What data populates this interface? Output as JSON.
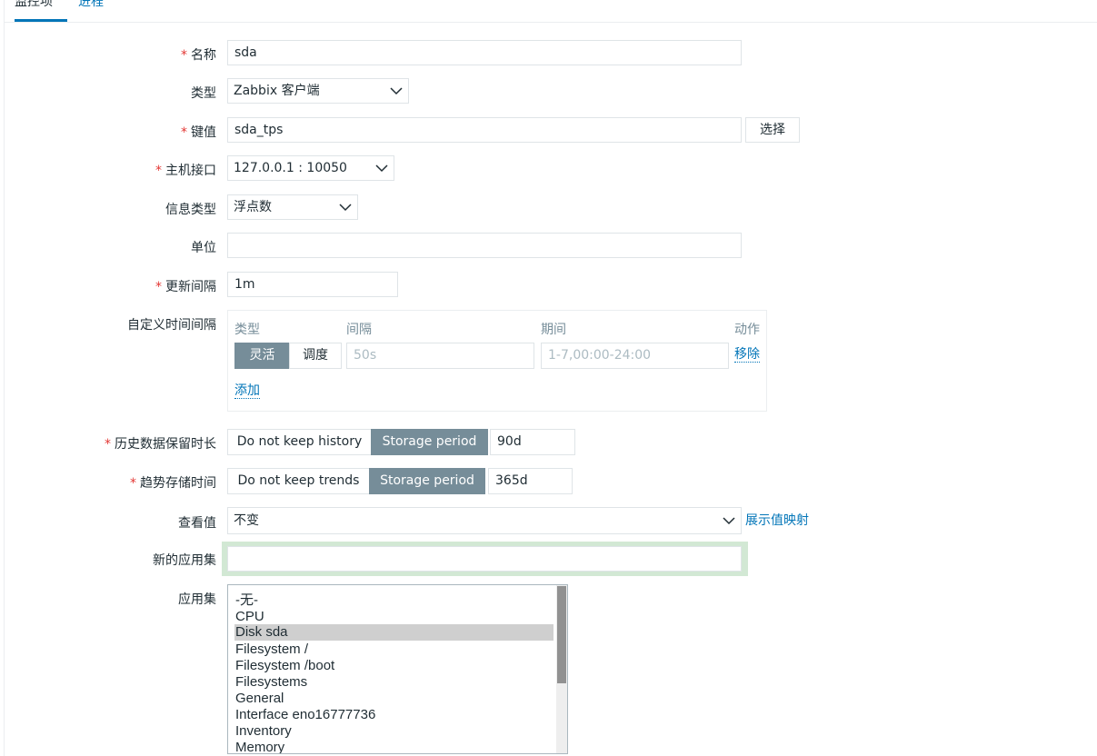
{
  "tabs": [
    {
      "label": "监控项"
    },
    {
      "label": "进程"
    }
  ],
  "form": {
    "required_mark": "*",
    "name": {
      "label": "名称",
      "value": "sda"
    },
    "type": {
      "label": "类型",
      "value": "Zabbix 客户端"
    },
    "key": {
      "label": "键值",
      "value": "sda_tps",
      "select_button": "选择"
    },
    "interface": {
      "label": "主机接口",
      "value": "127.0.0.1 : 10050"
    },
    "info_type": {
      "label": "信息类型",
      "value": "浮点数"
    },
    "units": {
      "label": "单位",
      "value": ""
    },
    "update_interval": {
      "label": "更新间隔",
      "value": "1m"
    },
    "custom_intervals": {
      "label": "自定义时间间隔",
      "headers": {
        "type": "类型",
        "interval": "间隔",
        "period": "期间",
        "action": "动作"
      },
      "row": {
        "mode_flexible": "灵活",
        "mode_scheduling": "调度",
        "interval_placeholder": "50s",
        "period_placeholder": "1-7,00:00-24:00",
        "remove": "移除"
      },
      "add": "添加"
    },
    "history": {
      "label": "历史数据保留时长",
      "option_off": "Do not keep history",
      "option_on": "Storage period",
      "value": "90d"
    },
    "trends": {
      "label": "趋势存储时间",
      "option_off": "Do not keep trends",
      "option_on": "Storage period",
      "value": "365d"
    },
    "valuemap": {
      "label": "查看值",
      "value": "不变",
      "link": "展示值映射"
    },
    "new_application": {
      "label": "新的应用集",
      "value": ""
    },
    "applications": {
      "label": "应用集",
      "options": [
        "-无-",
        "CPU",
        "Disk sda",
        "Filesystem /",
        "Filesystem /boot",
        "Filesystems",
        "General",
        "Interface eno16777736",
        "Inventory",
        "Memory"
      ],
      "selected": "Disk sda"
    }
  },
  "colors": {
    "accent": "#0275b8",
    "required": "#e33734",
    "active_button": "#768d99",
    "highlight": "#d2e8d4"
  }
}
